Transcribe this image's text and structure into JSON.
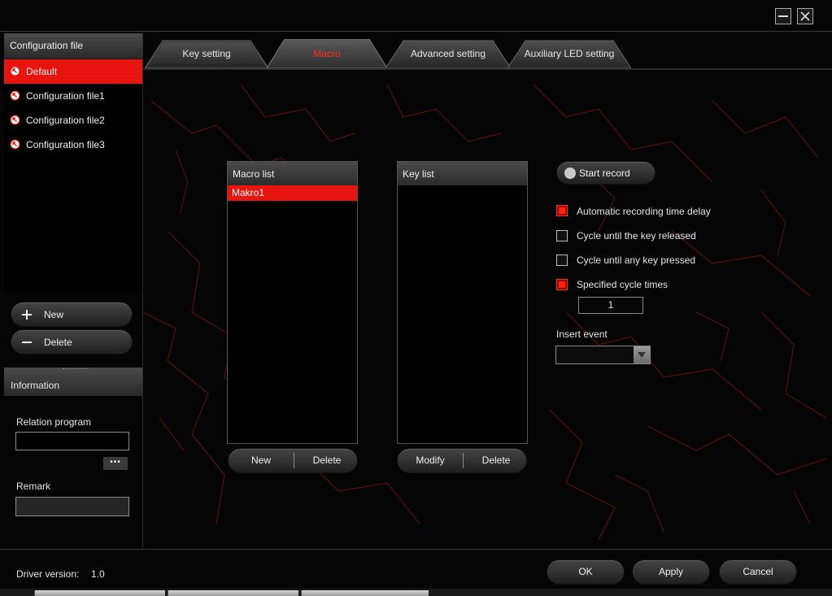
{
  "window": {
    "minimize_icon": "minimize-icon",
    "close_icon": "close-icon"
  },
  "sidebar": {
    "header": "Configuration file",
    "items": [
      {
        "label": "Default",
        "selected": true
      },
      {
        "label": "Configuration file1",
        "selected": false
      },
      {
        "label": "Configuration file2",
        "selected": false
      },
      {
        "label": "Configuration file3",
        "selected": false
      }
    ],
    "new_label": "New",
    "delete_label": "Delete"
  },
  "information": {
    "header": "Information",
    "relation_program_label": "Relation program",
    "relation_program_value": "",
    "browse_label": "•••",
    "remark_label": "Remark",
    "remark_value": ""
  },
  "tabs": [
    {
      "label": "Key setting",
      "active": false
    },
    {
      "label": "Macro",
      "active": true
    },
    {
      "label": "Advanced setting",
      "active": false
    },
    {
      "label": "Auxiliary LED setting",
      "active": false
    }
  ],
  "macro": {
    "macro_list": {
      "header": "Macro list",
      "items": [
        "Makro1"
      ],
      "new_label": "New",
      "delete_label": "Delete"
    },
    "key_list": {
      "header": "Key list",
      "items": [],
      "modify_label": "Modify",
      "delete_label": "Delete"
    },
    "start_record_label": "Start record",
    "options": [
      {
        "label": "Automatic recording time delay",
        "checked": true
      },
      {
        "label": "Cycle until the key released",
        "checked": false
      },
      {
        "label": "Cycle until any key pressed",
        "checked": false
      },
      {
        "label": "Specified cycle times",
        "checked": true
      }
    ],
    "cycle_times": "1",
    "insert_event_label": "Insert event",
    "insert_event_value": ""
  },
  "footer": {
    "driver_version_label": "Driver version:",
    "driver_version_value": "1.0",
    "ok_label": "OK",
    "apply_label": "Apply",
    "cancel_label": "Cancel"
  },
  "colors": {
    "accent": "#e8140e",
    "active_tab_text": "#ff2b1c",
    "background": "#050505"
  }
}
